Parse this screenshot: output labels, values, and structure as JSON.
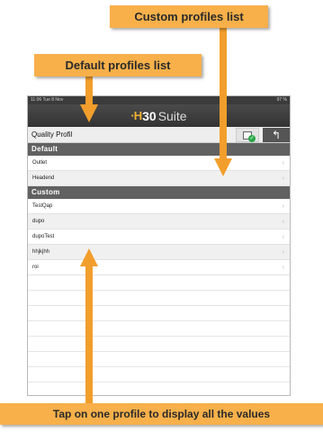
{
  "annotations": {
    "custom_profiles": "Custom profiles list",
    "default_profiles": "Default profiles list",
    "tap_hint": "Tap on one profile to display all the values"
  },
  "status_bar": {
    "time": "11:06 Tue 8 Nov",
    "right": "97 %"
  },
  "app_logo": {
    "mark": "·H",
    "number": "30",
    "word": "Suite"
  },
  "toolbar": {
    "title": "Quality Profil"
  },
  "sections": {
    "default": {
      "header": "Default",
      "items": [
        {
          "label": "Outlet"
        },
        {
          "label": "Headend"
        }
      ]
    },
    "custom": {
      "header": "Custom",
      "items": [
        {
          "label": "TestQap"
        },
        {
          "label": "dupo"
        },
        {
          "label": "dupoTest"
        },
        {
          "label": "hhjkjhh"
        },
        {
          "label": "roi"
        }
      ]
    }
  },
  "icons": {
    "chevron": "chevron-right-icon",
    "back": "back-arrow-icon",
    "check": "doc-check-icon"
  },
  "colors": {
    "callout": "#f7b04a",
    "arrow": "#f29e2c",
    "section_header": "#616161",
    "app_bar": "#3b3b3b"
  }
}
